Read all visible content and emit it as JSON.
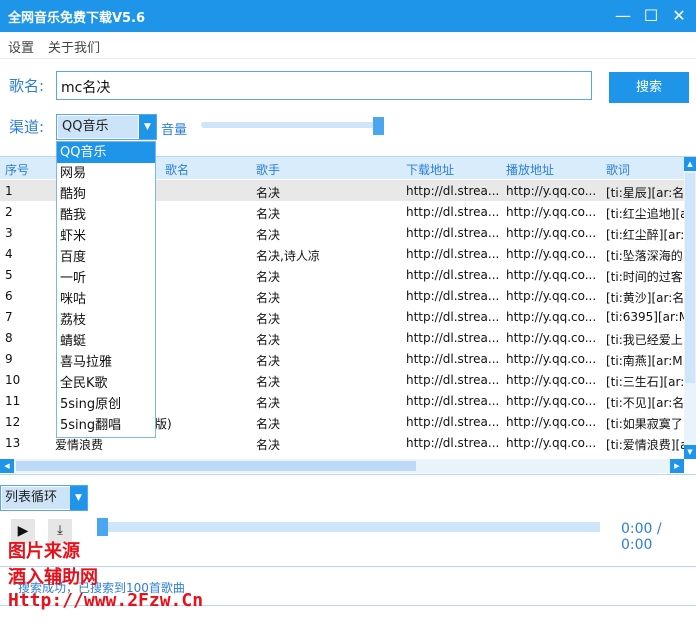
{
  "window": {
    "title": "全网音乐免费下载V5.6",
    "min": "—",
    "max": "☐",
    "close": "✕"
  },
  "menu": [
    "设置",
    "关于我们"
  ],
  "search": {
    "label": "歌名:",
    "value": "mc名决",
    "button": "搜索"
  },
  "channel": {
    "label": "渠道:",
    "selected": "QQ音乐",
    "options": [
      "QQ音乐",
      "网易",
      "酷狗",
      "酷我",
      "虾米",
      "百度",
      "一听",
      "咪咕",
      "荔枝",
      "蜻蜓",
      "喜马拉雅",
      "全民K歌",
      "5sing原创",
      "5sing翻唱"
    ]
  },
  "volume": {
    "label": "音量",
    "level": 0.95
  },
  "table": {
    "headers": [
      "序号",
      "歌名",
      "歌手",
      "下载地址",
      "播放地址",
      "歌词"
    ],
    "rows": [
      {
        "no": "1",
        "name": "",
        "singer": "名决",
        "dl": "http://dl.strea...",
        "play": "http://y.qq.co...",
        "lyric": "[ti:星辰][ar:名..."
      },
      {
        "no": "2",
        "name": "",
        "singer": "名决",
        "dl": "http://dl.strea...",
        "play": "http://y.qq.co...",
        "lyric": "[ti:红尘追地][a..."
      },
      {
        "no": "3",
        "name": "",
        "singer": "名决",
        "dl": "http://dl.strea...",
        "play": "http://y.qq.co...",
        "lyric": "[ti:红尘醉][ar:..."
      },
      {
        "no": "4",
        "name": "",
        "singer": "名决,诗人凉",
        "dl": "http://dl.strea...",
        "play": "http://y.qq.co...",
        "lyric": "[ti:坠落深海的..."
      },
      {
        "no": "5",
        "name": "",
        "singer": "名决",
        "dl": "http://dl.strea...",
        "play": "http://y.qq.co...",
        "lyric": "[ti:时间的过客..."
      },
      {
        "no": "6",
        "name": "",
        "singer": "名决",
        "dl": "http://dl.strea...",
        "play": "http://y.qq.co...",
        "lyric": "[ti:黄沙][ar:名..."
      },
      {
        "no": "7",
        "name": "",
        "singer": "名决",
        "dl": "http://dl.strea...",
        "play": "http://y.qq.co...",
        "lyric": "[ti:6395][ar:M..."
      },
      {
        "no": "8",
        "name": "",
        "singer": "名决",
        "dl": "http://dl.strea...",
        "play": "http://y.qq.co...",
        "lyric": "[ti:我已经爱上..."
      },
      {
        "no": "9",
        "name": "",
        "singer": "名决",
        "dl": "http://dl.strea...",
        "play": "http://y.qq.co...",
        "lyric": "[ti:南燕][ar:M..."
      },
      {
        "no": "10",
        "name": "",
        "singer": "名决",
        "dl": "http://dl.strea...",
        "play": "http://y.qq.co...",
        "lyric": "[ti:三生石][ar:..."
      },
      {
        "no": "11",
        "name": "",
        "singer": "名决",
        "dl": "http://dl.strea...",
        "play": "http://y.qq.co...",
        "lyric": "[ti:不见][ar:名..."
      },
      {
        "no": "12",
        "name": "版)",
        "singer": "名决",
        "dl": "http://dl.strea...",
        "play": "http://y.qq.co...",
        "lyric": "[ti:如果寂寞了..."
      },
      {
        "no": "13",
        "name": "爱情浪费",
        "singer": "名决",
        "dl": "http://dl.strea...",
        "play": "http://y.qq.co...",
        "lyric": "[ti:爱情浪费][a..."
      }
    ]
  },
  "player": {
    "loop_mode": "列表循环",
    "play_icon": "▶",
    "download_icon": "⤓",
    "time": "0:00 / 0:00",
    "progress": 0
  },
  "status": "搜索成功，已搜索到100首歌曲",
  "watermark": {
    "line1": "图片来源",
    "line2": "酒入辅助网",
    "line3": "Http://www.2Fzw.Cn"
  },
  "colors": {
    "accent": "#1e95e8",
    "label": "#2c7fd8",
    "watermark": "#e8101a"
  }
}
